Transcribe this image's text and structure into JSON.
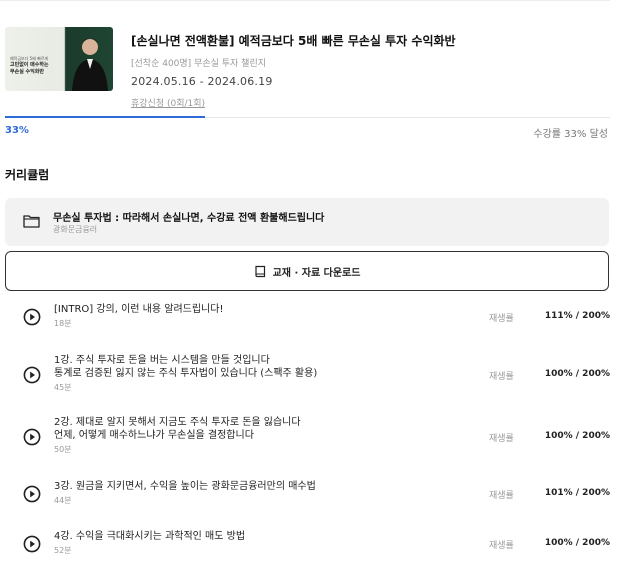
{
  "course": {
    "title": "[손실나면 전액환불] 예적금보다 5배 빠른 무손실 투자 수익화반",
    "subtitle": "[선착순 400명] 무손실 투자 챌린지",
    "date_range": "2024.05.16 - 2024.06.19",
    "apply_text": "휴강신청 (0회/1회)",
    "thumbnail": {
      "small_text": "예적금보다 5배 빠르게",
      "line1": "고민없이 매수하는",
      "line2": "무손실 수익화반"
    }
  },
  "progress": {
    "percent_label": "33%",
    "value": 0.33,
    "note": "수강률 33% 달성"
  },
  "curriculum": {
    "section_title": "커리큘럼",
    "folder": {
      "title": "무손실 투자법 : 따라해서 손실나면, 수강료 전액 환불해드립니다",
      "sub": "광화문금융러"
    },
    "download_label": "교재 · 자료 다운로드",
    "rate_label": "재생률",
    "lessons": [
      {
        "title_lines": [
          "[INTRO] 강의, 이런 내용 알려드립니다!"
        ],
        "duration": "18분",
        "rate": "111% / 200%"
      },
      {
        "title_lines": [
          "1강. 주식 투자로 돈을 버는 시스템을 만들 것입니다",
          "통계로 검증된 잃지 않는 주식 투자법이 있습니다 (스팩주 활용)"
        ],
        "duration": "45분",
        "rate": "100% / 200%"
      },
      {
        "title_lines": [
          "2강. 제대로 알지 못해서 지금도 주식 투자로 돈을 잃습니다",
          "언제, 어떻게 매수하느냐가 무손실을 결정합니다"
        ],
        "duration": "50분",
        "rate": "100% / 200%"
      },
      {
        "title_lines": [
          "3강. 원금을 지키면서, 수익을 높이는 광화문금융러만의 매수법"
        ],
        "duration": "44분",
        "rate": "101% / 200%"
      },
      {
        "title_lines": [
          "4강. 수익을 극대화시키는 과학적인 매도 방법"
        ],
        "duration": "52분",
        "rate": "100% / 200%"
      }
    ]
  }
}
